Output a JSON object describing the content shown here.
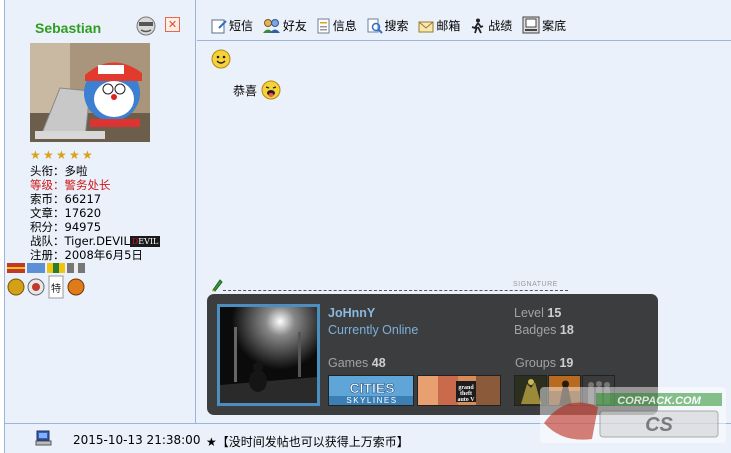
{
  "user": {
    "name": "Sebastian",
    "stars": 5,
    "title_line": "头衔：多啦",
    "rank_line": "等级：警务处长",
    "coins_line": "索币：66217",
    "posts_line": "文章：17620",
    "points_line": "积分：94975",
    "team_prefix": "战队：Tiger.DEVIL",
    "team_badge": "DEVIL",
    "reg_line": "注册：2008年6月5日"
  },
  "toolbar": {
    "items": [
      {
        "label": "短信",
        "icon": "sms-icon"
      },
      {
        "label": "好友",
        "icon": "friends-icon"
      },
      {
        "label": "信息",
        "icon": "info-icon"
      },
      {
        "label": "搜索",
        "icon": "search-icon"
      },
      {
        "label": "邮箱",
        "icon": "mail-icon"
      },
      {
        "label": "战绩",
        "icon": "record-icon"
      },
      {
        "label": "案底",
        "icon": "file-icon"
      }
    ]
  },
  "post": {
    "text": "恭喜"
  },
  "signature": {
    "label": "SIGNATURE",
    "steam": {
      "name": "JoHnnY",
      "status": "Currently Online",
      "level_label": "Level",
      "level": "15",
      "badges_label": "Badges",
      "badges": "18",
      "games_label": "Games",
      "games": "48",
      "groups_label": "Groups",
      "groups": "19",
      "games_shown": [
        "Cities Skylines",
        "Grand Theft Auto V",
        "Counter-Strike",
        "Counter-Strike: Source",
        "Left 4 Dead"
      ]
    }
  },
  "footer": {
    "time": "2015-10-13 21:38:00",
    "ad": "★【没时间发帖也可以获得上万索币】"
  },
  "watermark": "CORPACK.COM",
  "colors": {
    "accent_green": "#2E9E1E",
    "rank_red": "#D01818",
    "border": "#9DB3D8",
    "bg": "#EAF1FB",
    "steam_blue": "#8BB9E0"
  }
}
